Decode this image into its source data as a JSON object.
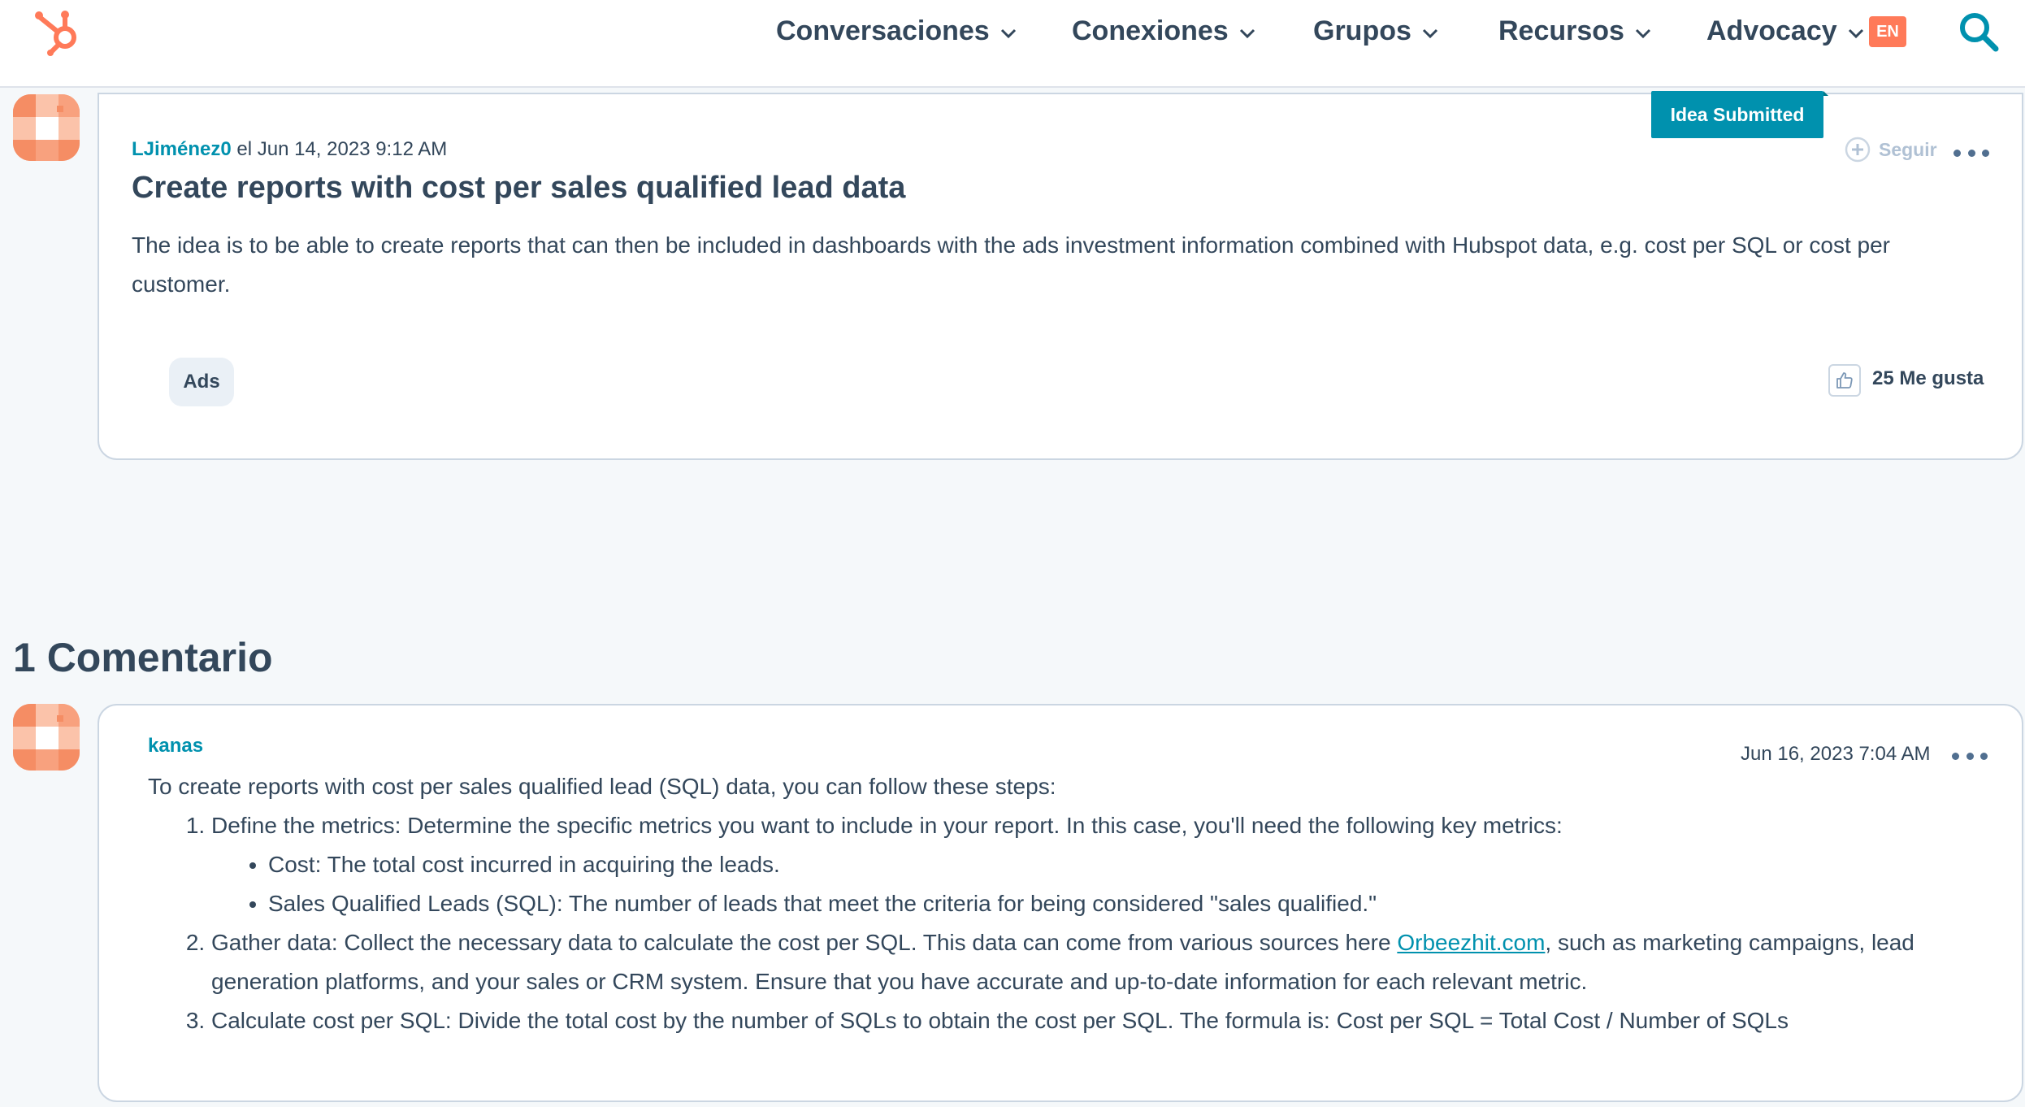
{
  "brand": {
    "accent": "#ff7a59",
    "link": "#0091ae",
    "text": "#33475b"
  },
  "nav": {
    "items": [
      {
        "label": "Conversaciones"
      },
      {
        "label": "Conexiones"
      },
      {
        "label": "Grupos"
      },
      {
        "label": "Recursos"
      },
      {
        "label": "Advocacy"
      }
    ],
    "language": "EN",
    "search_icon": "search-icon"
  },
  "post": {
    "status": "Idea Submitted",
    "author": "LJiménez0",
    "date_prefix": "el",
    "date": "Jun 14, 2023 9:12 AM",
    "follow_label": "Seguir",
    "title": "Create reports with cost per sales qualified lead data",
    "body": "The idea is to be able to create reports that can then be included in dashboards with the ads investment information combined with Hubspot data, e.g. cost per SQL or cost per customer.",
    "tag": "Ads",
    "likes": "25 Me gusta"
  },
  "comments": {
    "heading": "1 Comentario",
    "items": [
      {
        "author": "kanas",
        "date": "Jun 16, 2023 7:04 AM",
        "intro": "To create reports with cost per sales qualified lead (SQL) data, you can follow these steps:",
        "step1": "Define the metrics: Determine the specific metrics you want to include in your report. In this case, you'll need the following key metrics:",
        "step1_bullets": [
          "Cost: The total cost incurred in acquiring the leads.",
          "Sales Qualified Leads (SQL): The number of leads that meet the criteria for being considered \"sales qualified.\""
        ],
        "step2_before": "Gather data: Collect the necessary data to calculate the cost per SQL. This data can come from various sources here ",
        "step2_link": "Orbeezhit.com",
        "step2_after": ", such as marketing campaigns, lead generation platforms, and your sales or CRM system. Ensure that you have accurate and up-to-date information for each relevant metric.",
        "step3": "Calculate cost per SQL: Divide the total cost by the number of SQLs to obtain the cost per SQL. The formula is: Cost per SQL = Total Cost / Number of SQLs"
      }
    ]
  }
}
